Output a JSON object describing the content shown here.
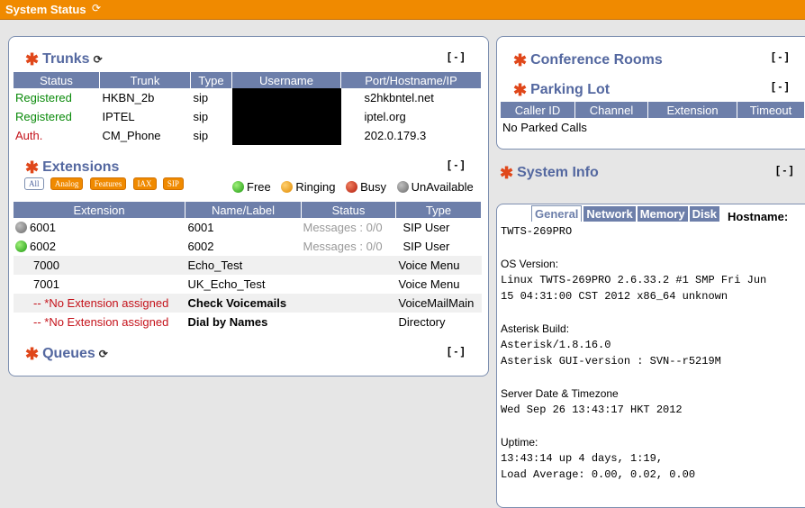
{
  "topbar": {
    "title": "System Status",
    "refresh_icon": "refresh-icon"
  },
  "trunks": {
    "title": "Trunks",
    "toggle": "[ - ]",
    "headers": [
      "Status",
      "Trunk",
      "Type",
      "Username",
      "Port/Hostname/IP"
    ],
    "rows": [
      {
        "status": "Registered",
        "status_color": "#0a8a0a",
        "trunk": "HKBN_2b",
        "type": "sip",
        "host": "s2hkbntel.net"
      },
      {
        "status": "Registered",
        "status_color": "#0a8a0a",
        "trunk": "IPTEL",
        "type": "sip",
        "host": "iptel.org"
      },
      {
        "status": "Auth.",
        "status_color": "#c4121a",
        "trunk": "CM_Phone",
        "type": "sip",
        "host": "202.0.179.3"
      }
    ]
  },
  "extensions": {
    "title": "Extensions",
    "toggle": "[ - ]",
    "filters": [
      "All",
      "Analog",
      "Features",
      "IAX",
      "SIP"
    ],
    "legend": [
      "Free",
      "Ringing",
      "Busy",
      "UnAvailable"
    ],
    "headers": [
      "Extension",
      "Name/Label",
      "Status",
      "Type"
    ],
    "rows": [
      {
        "dot": "grey",
        "ext": "6001",
        "name": "6001",
        "status": "Messages : 0/0",
        "type": "SIP User"
      },
      {
        "dot": "green",
        "ext": "6002",
        "name": "6002",
        "status": "Messages : 0/0",
        "type": "SIP User"
      },
      {
        "dot": "",
        "ext": "7000",
        "name": "Echo_Test",
        "status": "",
        "type": "Voice Menu"
      },
      {
        "dot": "",
        "ext": "7001",
        "name": "UK_Echo_Test",
        "status": "",
        "type": "Voice Menu"
      },
      {
        "dot": "",
        "ext": "-- *No Extension assigned",
        "name": "Check Voicemails",
        "status": "",
        "type": "VoiceMailMain"
      },
      {
        "dot": "",
        "ext": "-- *No Extension assigned",
        "name": "Dial by Names",
        "status": "",
        "type": "Directory"
      }
    ]
  },
  "queues": {
    "title": "Queues",
    "toggle": "[ - ]"
  },
  "conference": {
    "title": "Conference Rooms",
    "toggle": "[ - ]"
  },
  "parking": {
    "title": "Parking Lot",
    "toggle": "[ - ]",
    "headers": [
      "Caller ID",
      "Channel",
      "Extension",
      "Timeout"
    ],
    "empty_text": "No Parked Calls"
  },
  "system_info": {
    "title": "System Info",
    "toggle": "[ - ]",
    "tabs": [
      "General",
      "Network",
      "Memory",
      "Disk"
    ],
    "hostname_label": "Hostname:",
    "hostname_value": "TWTS-269PRO",
    "os_label": "OS Version:",
    "os_line1": "Linux TWTS-269PRO 2.6.33.2 #1 SMP Fri Jun",
    "os_line2": "15 04:31:00 CST 2012 x86_64 unknown",
    "asterisk_label": "Asterisk Build:",
    "asterisk_line1": "Asterisk/1.8.16.0",
    "asterisk_line2": "Asterisk GUI-version : SVN--r5219M",
    "date_label": "Server Date & Timezone",
    "date_value": "Wed Sep 26 13:43:17 HKT 2012",
    "uptime_label": "Uptime:",
    "uptime_line1": "13:43:14 up 4 days, 1:19,",
    "uptime_line2": "Load Average: 0.00, 0.02, 0.00"
  }
}
